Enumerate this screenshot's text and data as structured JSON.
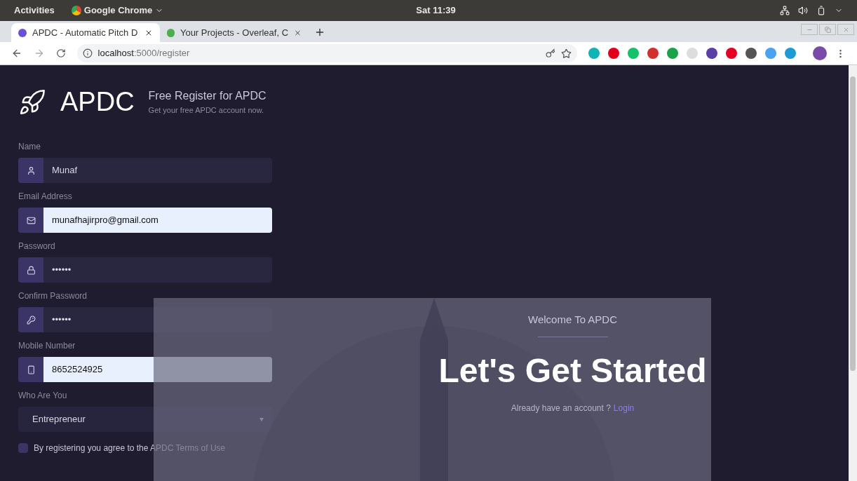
{
  "topbar": {
    "activities": "Activities",
    "app": "Google Chrome",
    "clock": "Sat 11:39"
  },
  "tabs": [
    {
      "title": "APDC - Automatic Pitch D",
      "selected": true
    },
    {
      "title": "Your Projects - Overleaf, C",
      "selected": false
    }
  ],
  "address": {
    "host": "localhost",
    "path": ":5000/register"
  },
  "brand": {
    "name": "APDC",
    "heading": "Free Register for APDC",
    "subheading": "Get your free APDC account now."
  },
  "fields": [
    {
      "kind": "text",
      "label": "Name",
      "value": "Munaf"
    },
    {
      "kind": "filled",
      "label": "Email Address",
      "value": "munafhajirpro@gmail.com"
    },
    {
      "kind": "text",
      "label": "Password",
      "value": "••••••"
    },
    {
      "kind": "text",
      "label": "Confirm Password",
      "value": "••••••"
    },
    {
      "kind": "filled",
      "label": "Mobile Number",
      "value": "8652524925"
    },
    {
      "kind": "select",
      "label": "Who Are You",
      "value": "Entrepreneur"
    }
  ],
  "terms": {
    "text": "By registering you agree to the APDC Terms of Use",
    "checked": false
  },
  "welcome": {
    "title": "Welcome To APDC",
    "headline": "Let's Get Started",
    "prompt": "Already have an account ?",
    "link": "Login"
  }
}
